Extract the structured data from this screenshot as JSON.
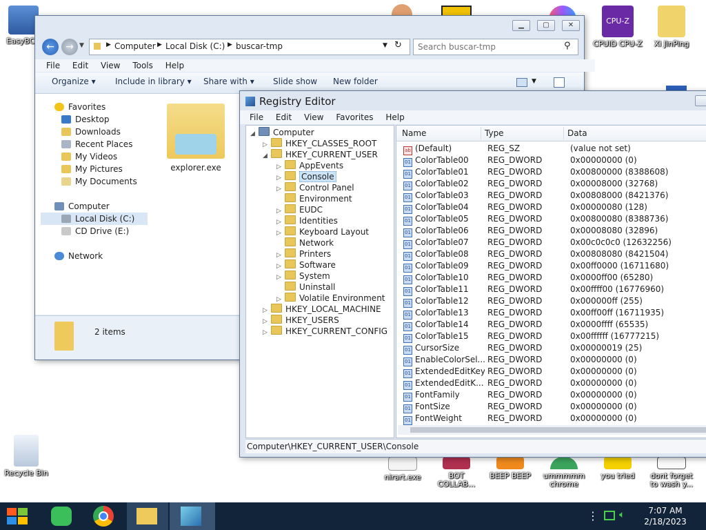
{
  "desktop": {
    "icons_top": [
      {
        "label": "EasyBCD"
      },
      {
        "label": "CPUID CPU-Z"
      },
      {
        "label": "Xi JinPing"
      }
    ],
    "recycle_bin": "Recycle Bin",
    "icons_bottom": [
      {
        "label": "nirart.exe"
      },
      {
        "label": "BOT COLLAB..."
      },
      {
        "label": "BEEP BEEP"
      },
      {
        "label": "ummmmm chrome"
      },
      {
        "label": "you tried"
      },
      {
        "label": "dont forget to wash y..."
      }
    ]
  },
  "explorer": {
    "address": {
      "seg1": "Computer",
      "seg2": "Local Disk (C:)",
      "seg3": "buscar-tmp"
    },
    "search_placeholder": "Search buscar-tmp",
    "menu": [
      "File",
      "Edit",
      "View",
      "Tools",
      "Help"
    ],
    "toolbar": {
      "organize": "Organize",
      "include": "Include in library",
      "share": "Share with",
      "slideshow": "Slide show",
      "newfolder": "New folder"
    },
    "nav": {
      "favorites": "Favorites",
      "desktop": "Desktop",
      "downloads": "Downloads",
      "recent": "Recent Places",
      "videos": "My Videos",
      "pictures": "My Pictures",
      "documents": "My Documents",
      "computer": "Computer",
      "localdisk": "Local Disk (C:)",
      "cddrive": "CD Drive (E:)",
      "network": "Network"
    },
    "file_label": "explorer.exe",
    "status": "2 items"
  },
  "regedit": {
    "title": "Registry Editor",
    "menu": [
      "File",
      "Edit",
      "View",
      "Favorites",
      "Help"
    ],
    "tree": {
      "computer": "Computer",
      "hkcr": "HKEY_CLASSES_ROOT",
      "hkcu": "HKEY_CURRENT_USER",
      "children": [
        "AppEvents",
        "Console",
        "Control Panel",
        "Environment",
        "EUDC",
        "Identities",
        "Keyboard Layout",
        "Network",
        "Printers",
        "Software",
        "System",
        "Uninstall",
        "Volatile Environment"
      ],
      "hklm": "HKEY_LOCAL_MACHINE",
      "hku": "HKEY_USERS",
      "hkcc": "HKEY_CURRENT_CONFIG"
    },
    "headers": {
      "name": "Name",
      "type": "Type",
      "data": "Data"
    },
    "values": [
      {
        "name": "(Default)",
        "type": "REG_SZ",
        "data": "(value not set)",
        "icon": "ab"
      },
      {
        "name": "ColorTable00",
        "type": "REG_DWORD",
        "data": "0x00000000 (0)",
        "icon": "bin"
      },
      {
        "name": "ColorTable01",
        "type": "REG_DWORD",
        "data": "0x00800000 (8388608)",
        "icon": "bin"
      },
      {
        "name": "ColorTable02",
        "type": "REG_DWORD",
        "data": "0x00008000 (32768)",
        "icon": "bin"
      },
      {
        "name": "ColorTable03",
        "type": "REG_DWORD",
        "data": "0x00808000 (8421376)",
        "icon": "bin"
      },
      {
        "name": "ColorTable04",
        "type": "REG_DWORD",
        "data": "0x00000080 (128)",
        "icon": "bin"
      },
      {
        "name": "ColorTable05",
        "type": "REG_DWORD",
        "data": "0x00800080 (8388736)",
        "icon": "bin"
      },
      {
        "name": "ColorTable06",
        "type": "REG_DWORD",
        "data": "0x00008080 (32896)",
        "icon": "bin"
      },
      {
        "name": "ColorTable07",
        "type": "REG_DWORD",
        "data": "0x00c0c0c0 (12632256)",
        "icon": "bin"
      },
      {
        "name": "ColorTable08",
        "type": "REG_DWORD",
        "data": "0x00808080 (8421504)",
        "icon": "bin"
      },
      {
        "name": "ColorTable09",
        "type": "REG_DWORD",
        "data": "0x00ff0000 (16711680)",
        "icon": "bin"
      },
      {
        "name": "ColorTable10",
        "type": "REG_DWORD",
        "data": "0x0000ff00 (65280)",
        "icon": "bin"
      },
      {
        "name": "ColorTable11",
        "type": "REG_DWORD",
        "data": "0x00ffff00 (16776960)",
        "icon": "bin"
      },
      {
        "name": "ColorTable12",
        "type": "REG_DWORD",
        "data": "0x000000ff (255)",
        "icon": "bin"
      },
      {
        "name": "ColorTable13",
        "type": "REG_DWORD",
        "data": "0x00ff00ff (16711935)",
        "icon": "bin"
      },
      {
        "name": "ColorTable14",
        "type": "REG_DWORD",
        "data": "0x0000ffff (65535)",
        "icon": "bin"
      },
      {
        "name": "ColorTable15",
        "type": "REG_DWORD",
        "data": "0x00ffffff (16777215)",
        "icon": "bin"
      },
      {
        "name": "CursorSize",
        "type": "REG_DWORD",
        "data": "0x00000019 (25)",
        "icon": "bin"
      },
      {
        "name": "EnableColorSel...",
        "type": "REG_DWORD",
        "data": "0x00000000 (0)",
        "icon": "bin"
      },
      {
        "name": "ExtendedEditKey",
        "type": "REG_DWORD",
        "data": "0x00000000 (0)",
        "icon": "bin"
      },
      {
        "name": "ExtendedEditK...",
        "type": "REG_DWORD",
        "data": "0x00000000 (0)",
        "icon": "bin"
      },
      {
        "name": "FontFamily",
        "type": "REG_DWORD",
        "data": "0x00000000 (0)",
        "icon": "bin"
      },
      {
        "name": "FontSize",
        "type": "REG_DWORD",
        "data": "0x00000000 (0)",
        "icon": "bin"
      },
      {
        "name": "FontWeight",
        "type": "REG_DWORD",
        "data": "0x00000000 (0)",
        "icon": "bin"
      }
    ],
    "statusbar": "Computer\\HKEY_CURRENT_USER\\Console"
  },
  "taskbar": {
    "time": "7:07 AM",
    "date": "2/18/2023"
  },
  "colors": {
    "accent": "#3b7bd1",
    "taskbar": "#11243a",
    "selection": "#cde4f7"
  }
}
